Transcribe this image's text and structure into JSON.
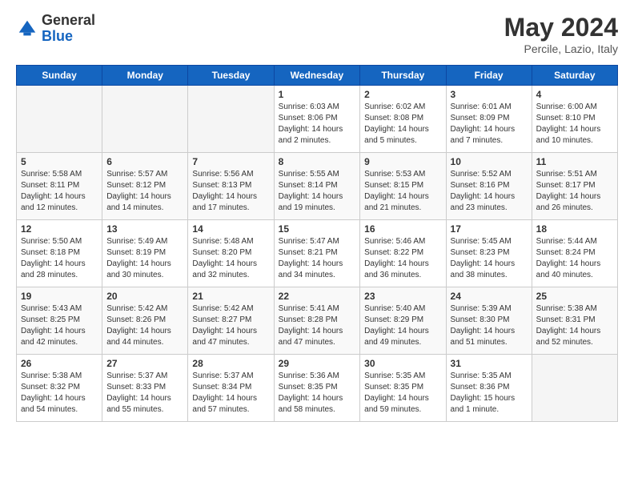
{
  "header": {
    "logo_general": "General",
    "logo_blue": "Blue",
    "month": "May 2024",
    "location": "Percile, Lazio, Italy"
  },
  "columns": [
    "Sunday",
    "Monday",
    "Tuesday",
    "Wednesday",
    "Thursday",
    "Friday",
    "Saturday"
  ],
  "weeks": [
    [
      {
        "day": "",
        "info": ""
      },
      {
        "day": "",
        "info": ""
      },
      {
        "day": "",
        "info": ""
      },
      {
        "day": "1",
        "info": "Sunrise: 6:03 AM\nSunset: 8:06 PM\nDaylight: 14 hours\nand 2 minutes."
      },
      {
        "day": "2",
        "info": "Sunrise: 6:02 AM\nSunset: 8:08 PM\nDaylight: 14 hours\nand 5 minutes."
      },
      {
        "day": "3",
        "info": "Sunrise: 6:01 AM\nSunset: 8:09 PM\nDaylight: 14 hours\nand 7 minutes."
      },
      {
        "day": "4",
        "info": "Sunrise: 6:00 AM\nSunset: 8:10 PM\nDaylight: 14 hours\nand 10 minutes."
      }
    ],
    [
      {
        "day": "5",
        "info": "Sunrise: 5:58 AM\nSunset: 8:11 PM\nDaylight: 14 hours\nand 12 minutes."
      },
      {
        "day": "6",
        "info": "Sunrise: 5:57 AM\nSunset: 8:12 PM\nDaylight: 14 hours\nand 14 minutes."
      },
      {
        "day": "7",
        "info": "Sunrise: 5:56 AM\nSunset: 8:13 PM\nDaylight: 14 hours\nand 17 minutes."
      },
      {
        "day": "8",
        "info": "Sunrise: 5:55 AM\nSunset: 8:14 PM\nDaylight: 14 hours\nand 19 minutes."
      },
      {
        "day": "9",
        "info": "Sunrise: 5:53 AM\nSunset: 8:15 PM\nDaylight: 14 hours\nand 21 minutes."
      },
      {
        "day": "10",
        "info": "Sunrise: 5:52 AM\nSunset: 8:16 PM\nDaylight: 14 hours\nand 23 minutes."
      },
      {
        "day": "11",
        "info": "Sunrise: 5:51 AM\nSunset: 8:17 PM\nDaylight: 14 hours\nand 26 minutes."
      }
    ],
    [
      {
        "day": "12",
        "info": "Sunrise: 5:50 AM\nSunset: 8:18 PM\nDaylight: 14 hours\nand 28 minutes."
      },
      {
        "day": "13",
        "info": "Sunrise: 5:49 AM\nSunset: 8:19 PM\nDaylight: 14 hours\nand 30 minutes."
      },
      {
        "day": "14",
        "info": "Sunrise: 5:48 AM\nSunset: 8:20 PM\nDaylight: 14 hours\nand 32 minutes."
      },
      {
        "day": "15",
        "info": "Sunrise: 5:47 AM\nSunset: 8:21 PM\nDaylight: 14 hours\nand 34 minutes."
      },
      {
        "day": "16",
        "info": "Sunrise: 5:46 AM\nSunset: 8:22 PM\nDaylight: 14 hours\nand 36 minutes."
      },
      {
        "day": "17",
        "info": "Sunrise: 5:45 AM\nSunset: 8:23 PM\nDaylight: 14 hours\nand 38 minutes."
      },
      {
        "day": "18",
        "info": "Sunrise: 5:44 AM\nSunset: 8:24 PM\nDaylight: 14 hours\nand 40 minutes."
      }
    ],
    [
      {
        "day": "19",
        "info": "Sunrise: 5:43 AM\nSunset: 8:25 PM\nDaylight: 14 hours\nand 42 minutes."
      },
      {
        "day": "20",
        "info": "Sunrise: 5:42 AM\nSunset: 8:26 PM\nDaylight: 14 hours\nand 44 minutes."
      },
      {
        "day": "21",
        "info": "Sunrise: 5:42 AM\nSunset: 8:27 PM\nDaylight: 14 hours\nand 47 minutes."
      },
      {
        "day": "22",
        "info": "Sunrise: 5:41 AM\nSunset: 8:28 PM\nDaylight: 14 hours\nand 47 minutes."
      },
      {
        "day": "23",
        "info": "Sunrise: 5:40 AM\nSunset: 8:29 PM\nDaylight: 14 hours\nand 49 minutes."
      },
      {
        "day": "24",
        "info": "Sunrise: 5:39 AM\nSunset: 8:30 PM\nDaylight: 14 hours\nand 51 minutes."
      },
      {
        "day": "25",
        "info": "Sunrise: 5:38 AM\nSunset: 8:31 PM\nDaylight: 14 hours\nand 52 minutes."
      }
    ],
    [
      {
        "day": "26",
        "info": "Sunrise: 5:38 AM\nSunset: 8:32 PM\nDaylight: 14 hours\nand 54 minutes."
      },
      {
        "day": "27",
        "info": "Sunrise: 5:37 AM\nSunset: 8:33 PM\nDaylight: 14 hours\nand 55 minutes."
      },
      {
        "day": "28",
        "info": "Sunrise: 5:37 AM\nSunset: 8:34 PM\nDaylight: 14 hours\nand 57 minutes."
      },
      {
        "day": "29",
        "info": "Sunrise: 5:36 AM\nSunset: 8:35 PM\nDaylight: 14 hours\nand 58 minutes."
      },
      {
        "day": "30",
        "info": "Sunrise: 5:35 AM\nSunset: 8:35 PM\nDaylight: 14 hours\nand 59 minutes."
      },
      {
        "day": "31",
        "info": "Sunrise: 5:35 AM\nSunset: 8:36 PM\nDaylight: 15 hours\nand 1 minute."
      },
      {
        "day": "",
        "info": ""
      }
    ]
  ]
}
